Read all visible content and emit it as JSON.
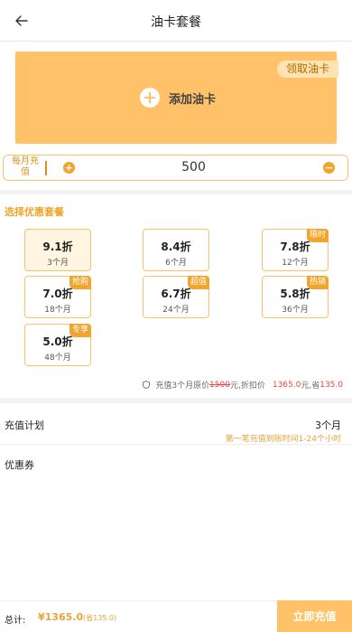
{
  "header": {
    "title": "油卡套餐",
    "back_icon": "arrow-left-icon"
  },
  "banner": {
    "claim_label": "领取油卡",
    "add_label": "添加油卡",
    "color": "#ffc269"
  },
  "monthly": {
    "label": "每月充值",
    "value": "500"
  },
  "plans_section": {
    "title": "选择优惠套餐"
  },
  "plans": [
    {
      "discount": "9.1折",
      "months": "3个月",
      "tag": "",
      "selected": true
    },
    {
      "discount": "8.4折",
      "months": "6个月",
      "tag": ""
    },
    {
      "discount": "7.8折",
      "months": "12个月",
      "tag": "限时"
    },
    {
      "discount": "7.0折",
      "months": "18个月",
      "tag": "抢购"
    },
    {
      "discount": "6.7折",
      "months": "24个月",
      "tag": "超值"
    },
    {
      "discount": "5.8折",
      "months": "36个月",
      "tag": "热销"
    },
    {
      "discount": "5.0折",
      "months": "48个月",
      "tag": "专享"
    }
  ],
  "summary": {
    "prefix": "充值3个月原价",
    "original": "1500",
    "middle": "元,折扣价",
    "price": "1365.0",
    "suffix": "元,省",
    "saved": "135.0"
  },
  "plan_info": {
    "label": "充值计划",
    "value": "3个月",
    "note": "第一笔充值到账时间1-24个小时"
  },
  "coupon": {
    "label": "优惠券"
  },
  "footer": {
    "total_label": "总计:",
    "total_value": "¥1365.0",
    "saved_text": "(省135.0)",
    "pay_label": "立即充值"
  }
}
